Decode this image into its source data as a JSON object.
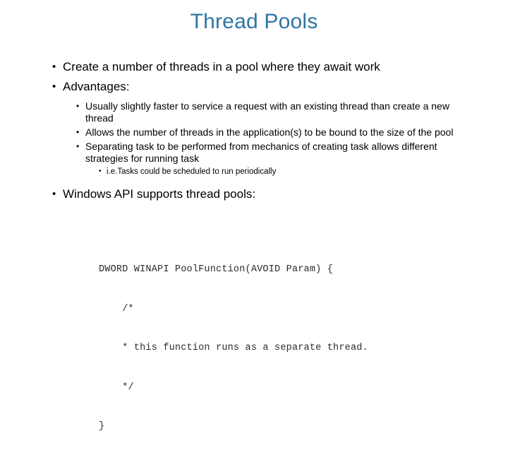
{
  "slide": {
    "title": "Thread Pools",
    "title_color": "#2E75A3",
    "background_color": "#FFFFFF",
    "bullet_glyph": "•"
  },
  "content": {
    "bullets": [
      {
        "level": 1,
        "text": "Create a number of threads in a pool where they await work"
      },
      {
        "level": 1,
        "text": "Advantages:"
      },
      {
        "level": 2,
        "text": "Usually slightly faster to service a request with an existing thread than create a new thread"
      },
      {
        "level": 2,
        "text": "Allows the number of threads in the application(s) to be bound to the size of the pool"
      },
      {
        "level": 2,
        "text": "Separating task to be performed from mechanics of creating task allows different strategies for running task"
      },
      {
        "level": 3,
        "text": "i.e.Tasks could be scheduled to run periodically"
      },
      {
        "level": 1,
        "text": "Windows API supports thread pools:"
      }
    ]
  },
  "code": {
    "language": "c",
    "lines": [
      "DWORD WINAPI PoolFunction(AVOID Param) {",
      "    /*",
      "    * this function runs as a separate thread.",
      "    */",
      "}"
    ]
  }
}
